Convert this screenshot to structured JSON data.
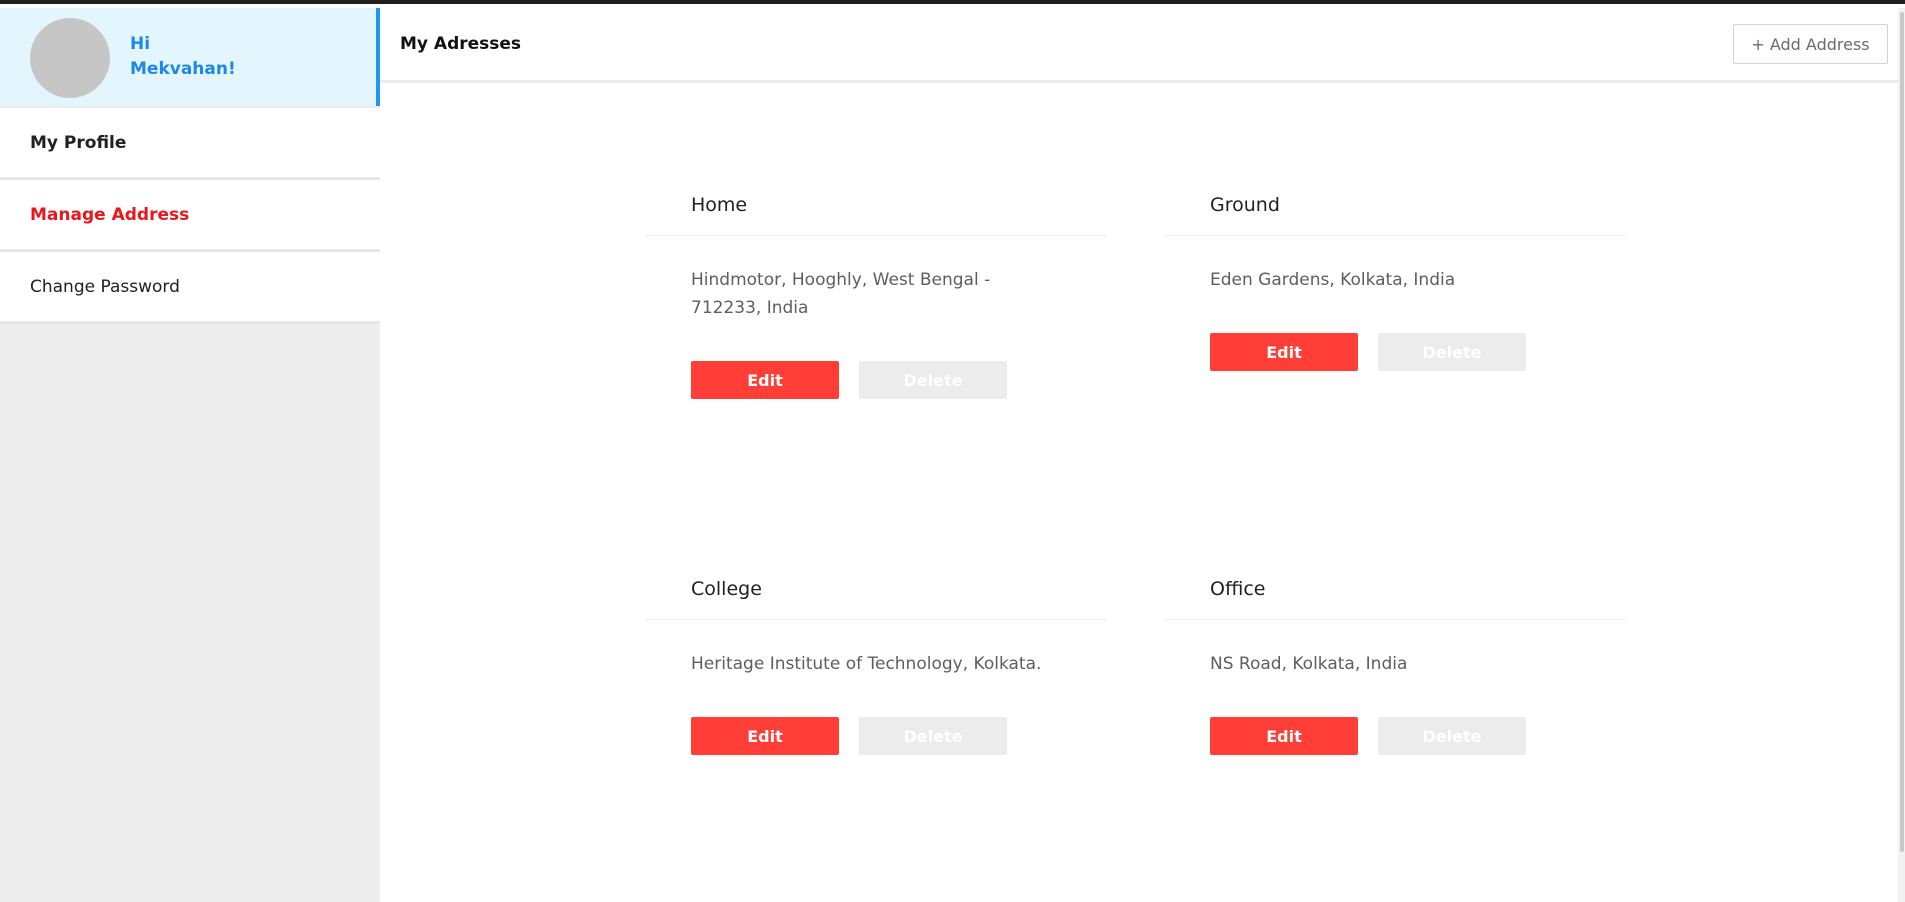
{
  "user": {
    "greeting_line1": "Hi",
    "greeting_line2": "Mekvahan!"
  },
  "menu": {
    "items": [
      {
        "label": "My Profile"
      },
      {
        "label": "Manage Address"
      },
      {
        "label": "Change Password"
      }
    ]
  },
  "header": {
    "title": "My Adresses",
    "add_button": "+ Add Address"
  },
  "addresses": [
    {
      "title": "Home",
      "address": "Hindmotor, Hooghly, West Bengal - 712233, India",
      "edit": "Edit",
      "delete": "Delete"
    },
    {
      "title": "Ground",
      "address": "Eden Gardens, Kolkata, India",
      "edit": "Edit",
      "delete": "Delete"
    },
    {
      "title": "College",
      "address": "Heritage Institute of Technology, Kolkata.",
      "edit": "Edit",
      "delete": "Delete"
    },
    {
      "title": "Office",
      "address": "NS Road, Kolkata, India",
      "edit": "Edit",
      "delete": "Delete"
    }
  ],
  "colors": {
    "accent_blue": "#2196f3",
    "active_red": "#e8171d",
    "edit_button": "#ff3f37",
    "delete_button": "#ececec"
  }
}
